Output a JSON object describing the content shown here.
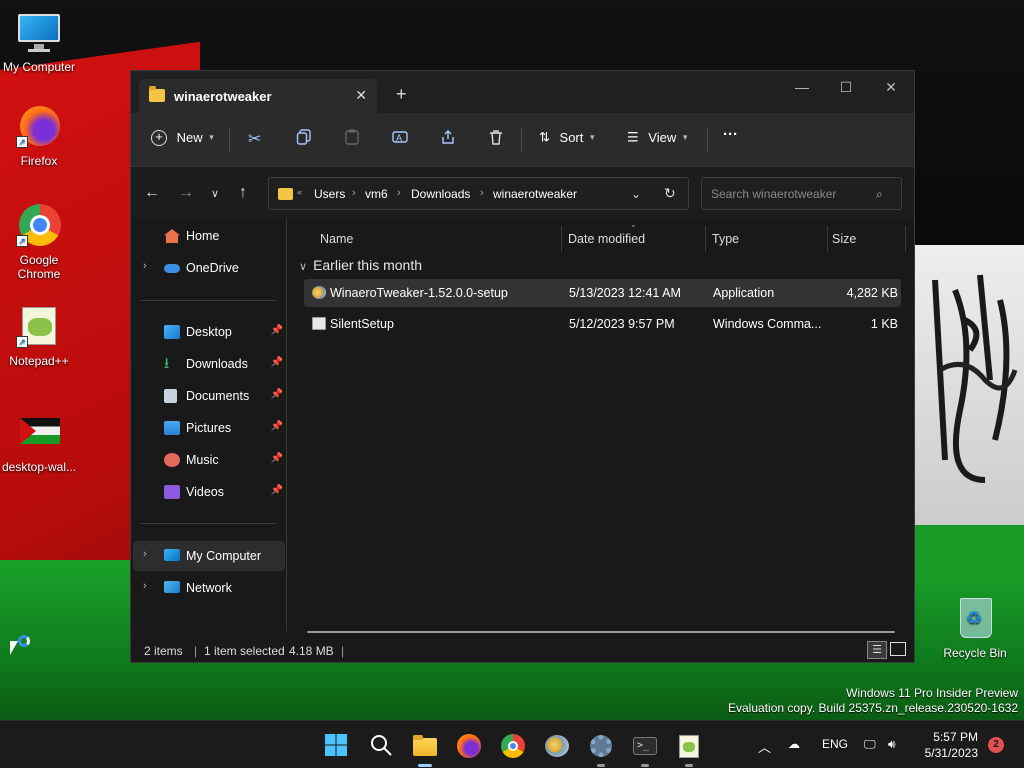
{
  "desktop": {
    "icons": [
      {
        "label": "My Computer",
        "icon": "monitor-icon"
      },
      {
        "label": "Firefox",
        "icon": "firefox-icon"
      },
      {
        "label": "Google Chrome",
        "icon": "chrome-icon"
      },
      {
        "label": "Notepad++",
        "icon": "notepadpp-icon"
      },
      {
        "label": "desktop-wal...",
        "icon": "image-file-icon"
      },
      {
        "label": "Recycle Bin",
        "icon": "recycle-bin-icon"
      }
    ],
    "watermark": {
      "line1": "Windows 11 Pro Insider Preview",
      "line2": "Evaluation copy. Build 25375.zn_release.230520-1632"
    }
  },
  "window": {
    "tab_title": "winaerotweaker",
    "toolbar": {
      "new_label": "New",
      "sort_label": "Sort",
      "view_label": "View",
      "more_label": "···"
    },
    "address": {
      "crumbs": [
        "Users",
        "vm6",
        "Downloads",
        "winaerotweaker"
      ]
    },
    "search": {
      "placeholder": "Search winaerotweaker"
    },
    "sidebar": {
      "items": [
        {
          "label": "Home"
        },
        {
          "label": "OneDrive"
        },
        {
          "label": "Desktop"
        },
        {
          "label": "Downloads"
        },
        {
          "label": "Documents"
        },
        {
          "label": "Pictures"
        },
        {
          "label": "Music"
        },
        {
          "label": "Videos"
        },
        {
          "label": "My Computer"
        },
        {
          "label": "Network"
        }
      ]
    },
    "columns": {
      "name": "Name",
      "date": "Date modified",
      "type": "Type",
      "size": "Size"
    },
    "group_label": "Earlier this month",
    "files": [
      {
        "name": "WinaeroTweaker-1.52.0.0-setup",
        "date": "5/13/2023 12:41 AM",
        "type": "Application",
        "size": "4,282 KB"
      },
      {
        "name": "SilentSetup",
        "date": "5/12/2023 9:57 PM",
        "type": "Windows Comma...",
        "size": "1 KB"
      }
    ],
    "status": {
      "count": "2 items",
      "selected": "1 item selected",
      "size": "4.18 MB"
    }
  },
  "taskbar": {
    "lang": "ENG",
    "time": "5:57 PM",
    "date": "5/31/2023",
    "notifications": "2"
  }
}
